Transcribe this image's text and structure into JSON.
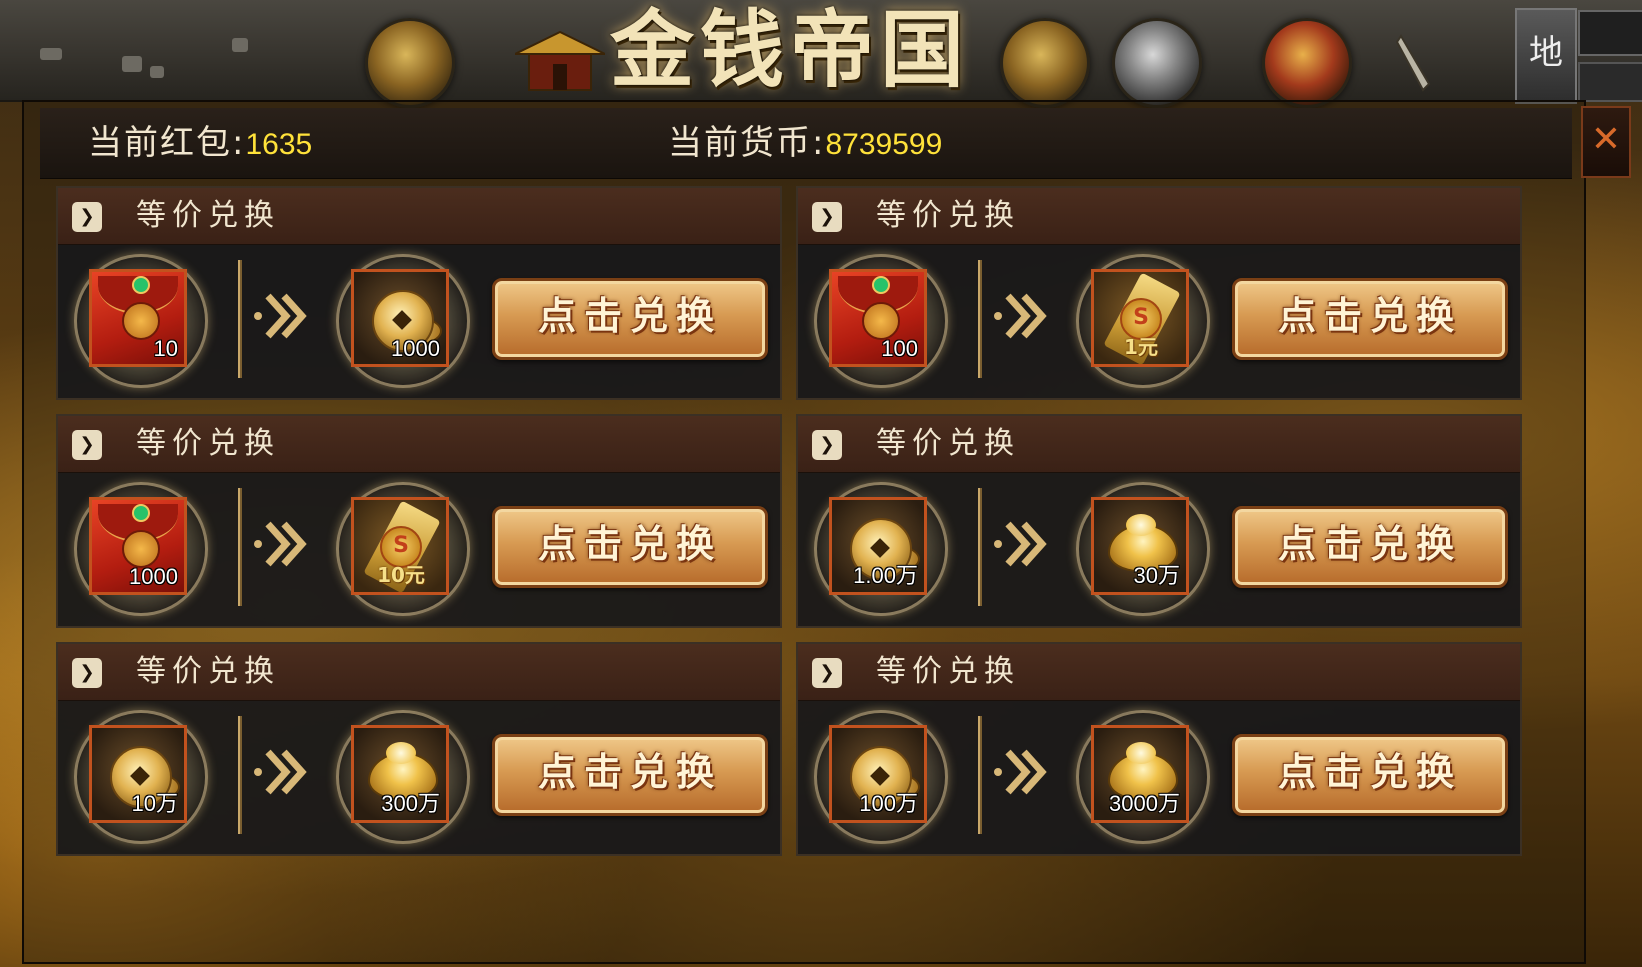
{
  "hud": {
    "game_title": "金钱帝国",
    "side_tab_label": "地",
    "icons": [
      "compass-orb-icon",
      "temple-icon",
      "gold-orb-icon",
      "dice-orb-icon",
      "treasure-orb-icon",
      "sword-icon"
    ]
  },
  "currency": {
    "red_packet_label": "当前红包:",
    "red_packet_value": "1635",
    "coin_label": "当前货币:",
    "coin_value": "8739599"
  },
  "close_icon": "✕",
  "colors": {
    "value_yellow": "#ffe23a",
    "button_orange": "#d79a52",
    "header_brown": "#4b2d1e",
    "item_border": "#c2521e"
  },
  "exchanges": [
    {
      "title": "等价兑换",
      "from": {
        "icon": "red-packet-icon",
        "count": "10"
      },
      "to": {
        "icon": "copper-coin-icon",
        "count": "1000"
      },
      "button": "点击兑换"
    },
    {
      "title": "等价兑换",
      "from": {
        "icon": "red-packet-icon",
        "count": "100"
      },
      "to": {
        "icon": "gold-ticket-icon",
        "count": "",
        "ticket_text": "1元"
      },
      "button": "点击兑换"
    },
    {
      "title": "等价兑换",
      "from": {
        "icon": "red-packet-icon",
        "count": "1000"
      },
      "to": {
        "icon": "gold-ticket-icon",
        "count": "",
        "ticket_text": "10元"
      },
      "button": "点击兑换"
    },
    {
      "title": "等价兑换",
      "from": {
        "icon": "copper-coin-icon",
        "count": "1.00万"
      },
      "to": {
        "icon": "gold-ingot-icon",
        "count": "30万"
      },
      "button": "点击兑换"
    },
    {
      "title": "等价兑换",
      "from": {
        "icon": "copper-coin-icon",
        "count": "10万"
      },
      "to": {
        "icon": "gold-ingot-icon",
        "count": "300万"
      },
      "button": "点击兑换"
    },
    {
      "title": "等价兑换",
      "from": {
        "icon": "copper-coin-icon",
        "count": "100万"
      },
      "to": {
        "icon": "gold-ingot-icon",
        "count": "3000万"
      },
      "button": "点击兑换"
    }
  ]
}
